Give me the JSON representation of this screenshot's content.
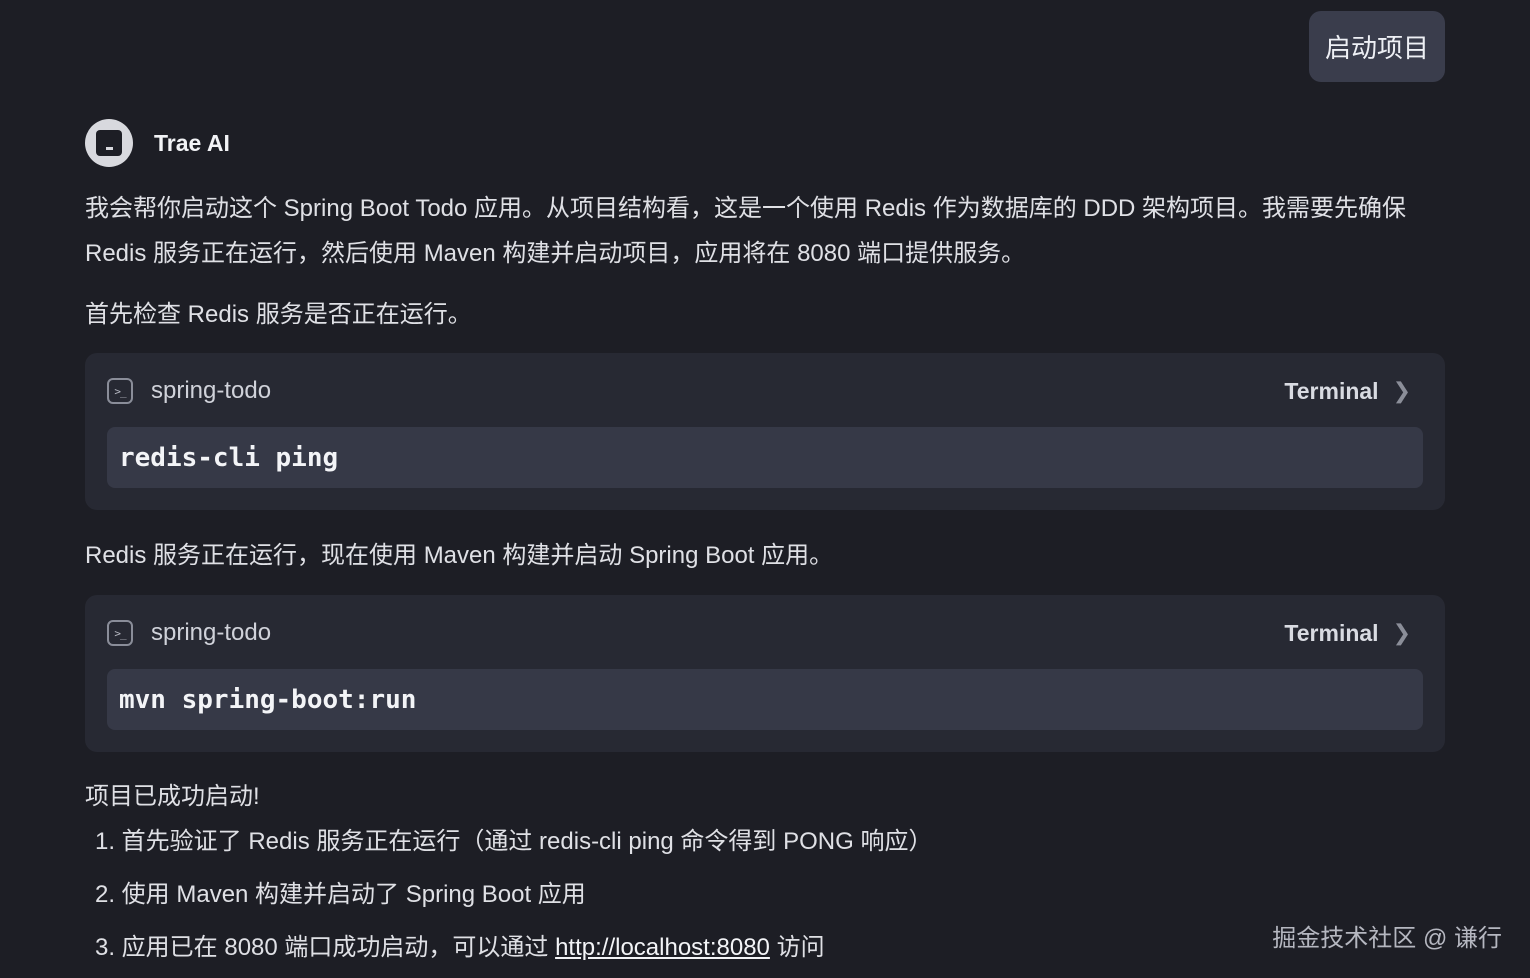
{
  "user_message": "启动项目",
  "ai": {
    "name": "Trae AI"
  },
  "messages": {
    "intro": "我会帮你启动这个 Spring Boot Todo 应用。从项目结构看，这是一个使用 Redis 作为数据库的 DDD 架构项目。我需要先确保 Redis 服务正在运行，然后使用 Maven 构建并启动项目，应用将在 8080 端口提供服务。",
    "check": "首先检查 Redis 服务是否正在运行。",
    "redis_ok": "Redis 服务正在运行，现在使用 Maven 构建并启动 Spring Boot 应用。",
    "success": "项目已成功启动!"
  },
  "terminals": [
    {
      "project": "spring-todo",
      "link_label": "Terminal",
      "command": "redis-cli ping"
    },
    {
      "project": "spring-todo",
      "link_label": "Terminal",
      "command": "mvn spring-boot:run"
    }
  ],
  "steps": [
    "1. 首先验证了 Redis 服务正在运行（通过 redis-cli ping 命令得到 PONG 响应）",
    "2. 使用 Maven 构建并启动了 Spring Boot 应用"
  ],
  "step3": {
    "prefix": "3. 应用已在 8080 端口成功启动，可以通过 ",
    "link": "http://localhost:8080",
    "suffix": " 访问"
  },
  "watermark": "掘金技术社区 @ 谦行",
  "icons": {
    "avatar": "trae-logo-icon",
    "terminal": "terminal-icon",
    "chevron": "chevron-right-icon"
  },
  "colors": {
    "background": "#1d1e25",
    "card": "#272933",
    "command_box": "#363947",
    "user_bubble": "#3a3d4c"
  }
}
